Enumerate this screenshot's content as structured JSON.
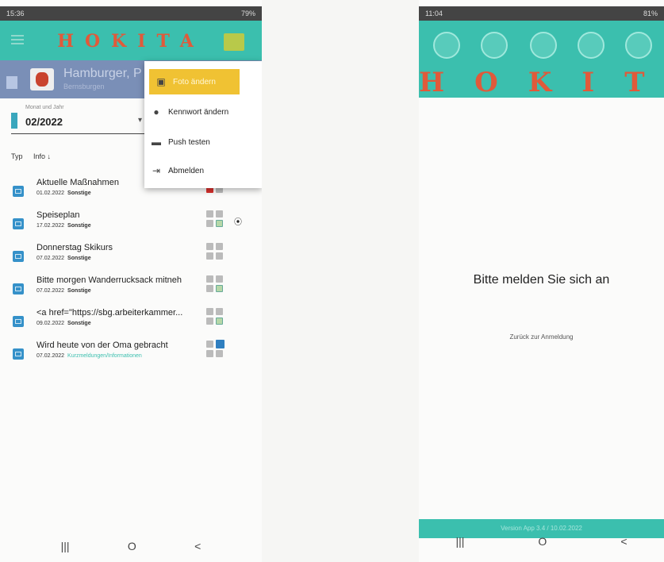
{
  "colors": {
    "banner": "#3bbfae",
    "profile_bar": "#7a8fb7",
    "menu_active": "#f0c233",
    "row_icon": "#3591c9"
  },
  "left": {
    "status": {
      "time": "15:36",
      "battery": "79%"
    },
    "banner": {
      "title": "HOKITA"
    },
    "profile": {
      "name": "Hamburger, P",
      "subtitle": "Bernsburgen"
    },
    "month": {
      "label": "Monat und Jahr",
      "value": "02/2022"
    },
    "columns": {
      "type": "Typ",
      "info": "Info ↓"
    },
    "menu": {
      "items": [
        {
          "label": "Foto ändern",
          "icon": "photo-icon"
        },
        {
          "label": "Kennwort ändern",
          "icon": "account-icon"
        },
        {
          "label": "Push testen",
          "icon": "message-icon"
        },
        {
          "label": "Abmelden",
          "icon": "logout-icon"
        }
      ]
    },
    "rows": [
      {
        "title": "Aktuelle Maßnahmen",
        "date": "01.02.2022",
        "category": "Sonstige"
      },
      {
        "title": "Speiseplan",
        "date": "17.02.2022",
        "category": "Sonstige"
      },
      {
        "title": "Donnerstag Skikurs",
        "date": "07.02.2022",
        "category": "Sonstige"
      },
      {
        "title": "Bitte morgen Wanderrucksack mitneh",
        "date": "07.02.2022",
        "category": "Sonstige"
      },
      {
        "title": "<a href=\"https://sbg.arbeiterkammer...",
        "date": "09.02.2022",
        "category": "Sonstige"
      },
      {
        "title": "Wird heute von der Oma gebracht",
        "date": "07.02.2022",
        "category": "Kurzmeldungen/Informationen"
      }
    ],
    "navbar": {
      "recents": "|||",
      "home": "O",
      "back": "<"
    }
  },
  "right": {
    "status": {
      "time": "11:04",
      "battery": "81%"
    },
    "banner": {
      "title": "HOKITA"
    },
    "login_title": "Bitte melden Sie sich an",
    "back_link": "Zurück zur Anmeldung",
    "version": "Version App 3.4 / 10.02.2022",
    "navbar": {
      "recents": "|||",
      "home": "O",
      "back": "<"
    }
  }
}
